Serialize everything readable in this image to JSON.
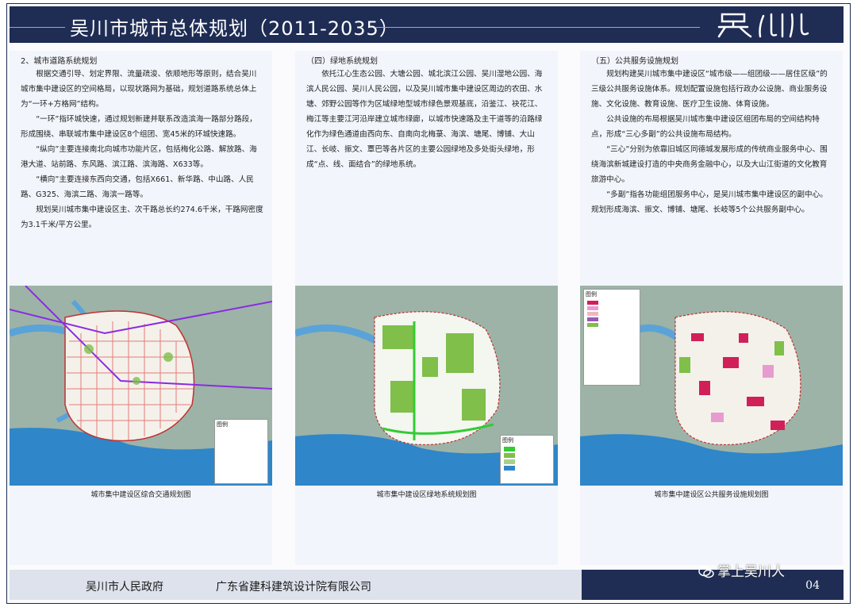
{
  "header": {
    "title": "吴川市城市总体规划（2011-2035）",
    "logo_text": "吴川"
  },
  "columns": [
    {
      "heading": "2、城市道路系统规划",
      "paragraphs": [
        "根据交通引导、划定界限、流量疏浚、依顺地形等原则，结合吴川城市集中建设区的空间格局，以现状路网为基础，规划道路系统总体上为“一环+方格网”结构。",
        "“一环”指环城快速，通过规划新建并联系改造滨海一路部分路段，形成围绕、串联城市集中建设区8个组团、宽45米的环城快速路。",
        "“纵向”主要连接南北向城市功能片区，包括梅化公路、解放路、海港大道、站前路、东风路、滨江路、滨海路、X633等。",
        "“横向”主要连接东西向交通，包括X661、新华路、中山路、人民路、G325、海滨二路、海滨一路等。",
        "规划吴川城市集中建设区主、次干路总长约274.6千米，干路网密度为3.1千米/平方公里。"
      ],
      "map_caption": "城市集中建设区综合交通规划图",
      "legend_title": "图例"
    },
    {
      "heading": "（四）绿地系统规划",
      "paragraphs": [
        "依托江心生态公园、大塘公园、城北滨江公园、吴川湿地公园、海滨人民公园、吴川人民公园，以及吴川城市集中建设区周边的农田、水塘、郊野公园等作为区域绿地型城市绿色景观基底，沿鉴江、袂花江、梅江等主要江河沿岸建立城市绿廊，以城市快速路及主干道等的沿路绿化作为绿色通道由西向东、自南向北梅菉、海滨、塘尾、博铺、大山江、长岐、振文、覃巴等各片区的主要公园绿地及多处街头绿地，形成“点、线、面结合”的绿地系统。"
      ],
      "map_caption": "城市集中建设区绿地系统规划图",
      "legend_title": "图例"
    },
    {
      "heading": "（五）公共服务设施规划",
      "paragraphs": [
        "规划构建吴川城市集中建设区“城市级——组团级——居住区级”的三级公共服务设施体系。规划配置设施包括行政办公设施、商业服务设施、文化设施、教育设施、医疗卫生设施、体育设施。",
        "公共设施的布局根据吴川城市集中建设区组团布局的空间结构特点，形成“三心多副”的公共设施布局结构。",
        "“三心”分别为依靠旧城区同德城发展形成的传统商业服务中心、围绕海滨新城建设打造的中央商务金融中心，以及大山江街道的文化教育旅游中心。",
        "“多副”指各功能组团服务中心，是吴川城市集中建设区的副中心。规划形成海滨、振文、博铺、塘尾、长岐等5个公共服务副中心。"
      ],
      "map_caption": "城市集中建设区公共服务设施规划图",
      "legend_title": "图例"
    }
  ],
  "footer": {
    "org1": "吴川市人民政府",
    "org2": "广东省建科建筑设计院有限公司",
    "page": "04"
  },
  "watermark": "掌上吴川人",
  "colors": {
    "navy": "#1f2d55",
    "sea": "#2f86c9",
    "green": "#7fbf4a",
    "urban": "#f4f1ea",
    "red": "#d11f5a"
  }
}
